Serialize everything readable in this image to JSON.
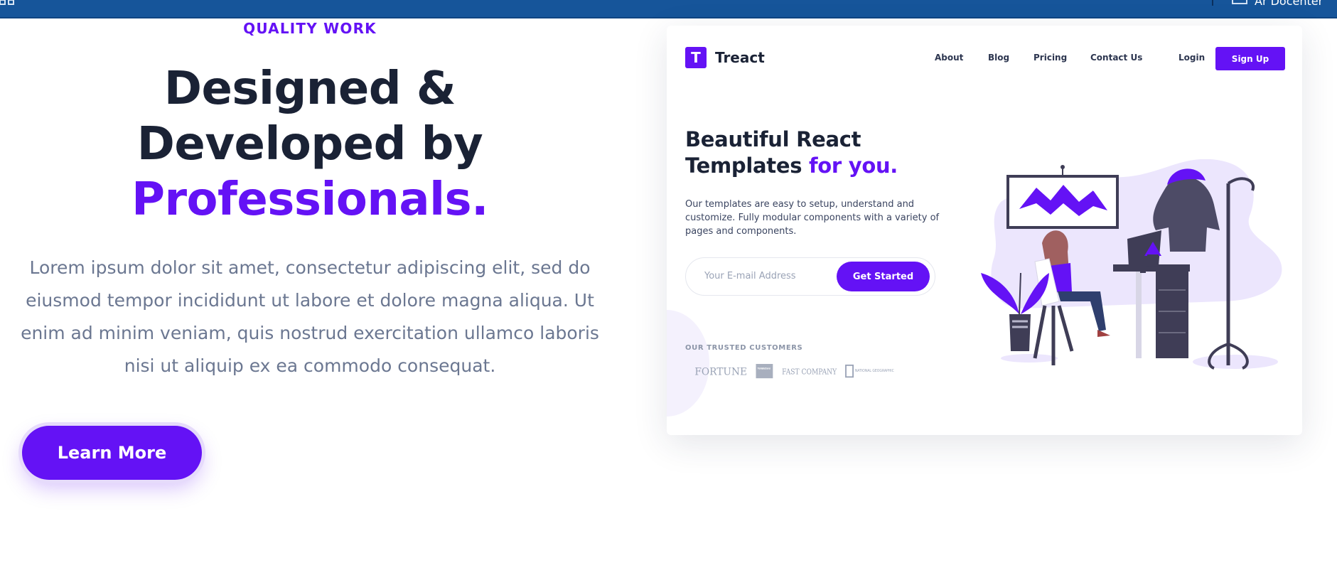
{
  "topbar": {
    "account_text": "Ar Docenter"
  },
  "hero": {
    "eyebrow": "QUALITY WORK",
    "headline_line1": "Designed &",
    "headline_line2": "Developed by",
    "headline_accent": "Professionals.",
    "lead": "Lorem ipsum dolor sit amet, consectetur adipiscing elit, sed do eiusmod tempor incididunt ut labore et dolore magna aliqua. Ut enim ad minim veniam, quis nostrud exercitation ullamco laboris nisi ut aliquip ex ea commodo consequat.",
    "cta_label": "Learn More"
  },
  "preview": {
    "logo_letter": "T",
    "logo_text": "Treact",
    "nav": [
      "About",
      "Blog",
      "Pricing",
      "Contact Us",
      "Login"
    ],
    "signup_label": "Sign Up",
    "title_line1": "Beautiful React",
    "title_line2": "Templates",
    "title_accent": "for you.",
    "description": "Our templates are easy to setup, understand and customize. Fully modular components with a variety of pages and components.",
    "email_placeholder": "Your E-mail Address",
    "get_started_label": "Get Started",
    "trusted_label": "OUR TRUSTED CUSTOMERS",
    "customer_logos": [
      "FORTUNE",
      "The Weather Channel",
      "FAST COMPANY",
      "NATIONAL GEOGRAPHIC"
    ]
  },
  "colors": {
    "accent": "#6412f5",
    "topbar": "#16559a",
    "heading": "#1a2235",
    "body_text": "#6b7791"
  }
}
